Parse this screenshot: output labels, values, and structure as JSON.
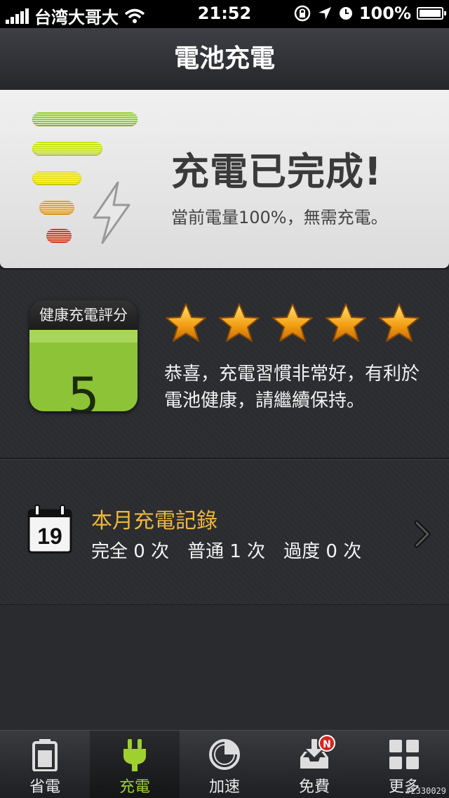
{
  "status_bar": {
    "carrier": "台湾大哥大",
    "time": "21:52",
    "battery": "100%"
  },
  "navbar": {
    "title": "電池充電"
  },
  "charge_status": {
    "title": "充電已完成!",
    "subtitle": "當前電量100%，無需充電。",
    "level_colors": [
      "#8fd11e",
      "#c8e21a",
      "#e8e012",
      "#f0a012",
      "#e0371a"
    ]
  },
  "health": {
    "card_title": "健康充電評分",
    "score": "5",
    "stars": 5,
    "message": "恭喜，充電習慣非常好，有利於電池健康，請繼續保持。"
  },
  "monthly": {
    "calendar_day": "19",
    "title": "本月充電記錄",
    "stats": [
      "完全 0 次",
      "普通 1 次",
      "過度 0 次"
    ]
  },
  "tabs": [
    {
      "label": "省電",
      "icon": "battery-icon",
      "active": false
    },
    {
      "label": "充電",
      "icon": "plug-icon",
      "active": true
    },
    {
      "label": "加速",
      "icon": "pie-icon",
      "active": false
    },
    {
      "label": "免費",
      "icon": "download-tray-icon",
      "active": false,
      "badge": "N"
    },
    {
      "label": "更多",
      "icon": "grid-icon",
      "active": false
    }
  ],
  "watermark": "#2330029",
  "colors": {
    "accent_green": "#9ed12f",
    "orange_title": "#f0b63c",
    "score_green": "#8dc337"
  }
}
